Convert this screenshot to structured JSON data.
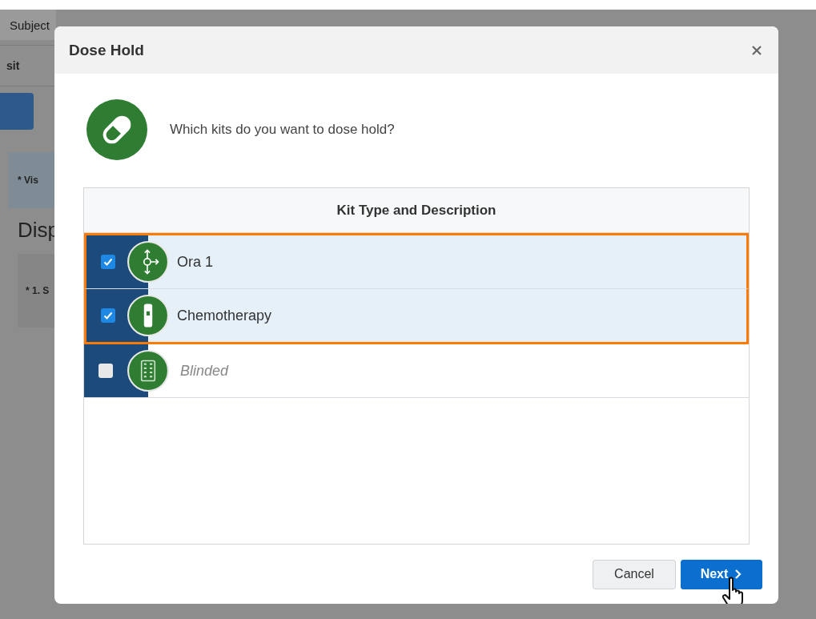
{
  "background": {
    "tab": "Subject",
    "column_1": "sit",
    "field": "* Vis",
    "heading": "Disp",
    "question": "* 1. S"
  },
  "dialog": {
    "title": "Dose Hold",
    "prompt": "Which kits do you want to dose hold?",
    "table": {
      "header": "Kit Type and Description",
      "rows": [
        {
          "label": "Ora 1",
          "checked": true,
          "disabled": false
        },
        {
          "label": "Chemotherapy",
          "checked": true,
          "disabled": false
        },
        {
          "label": "Blinded",
          "checked": false,
          "disabled": true
        }
      ]
    },
    "buttons": [
      {
        "label": "Cancel",
        "kind": "secondary"
      },
      {
        "label": "Next",
        "kind": "primary"
      }
    ]
  }
}
